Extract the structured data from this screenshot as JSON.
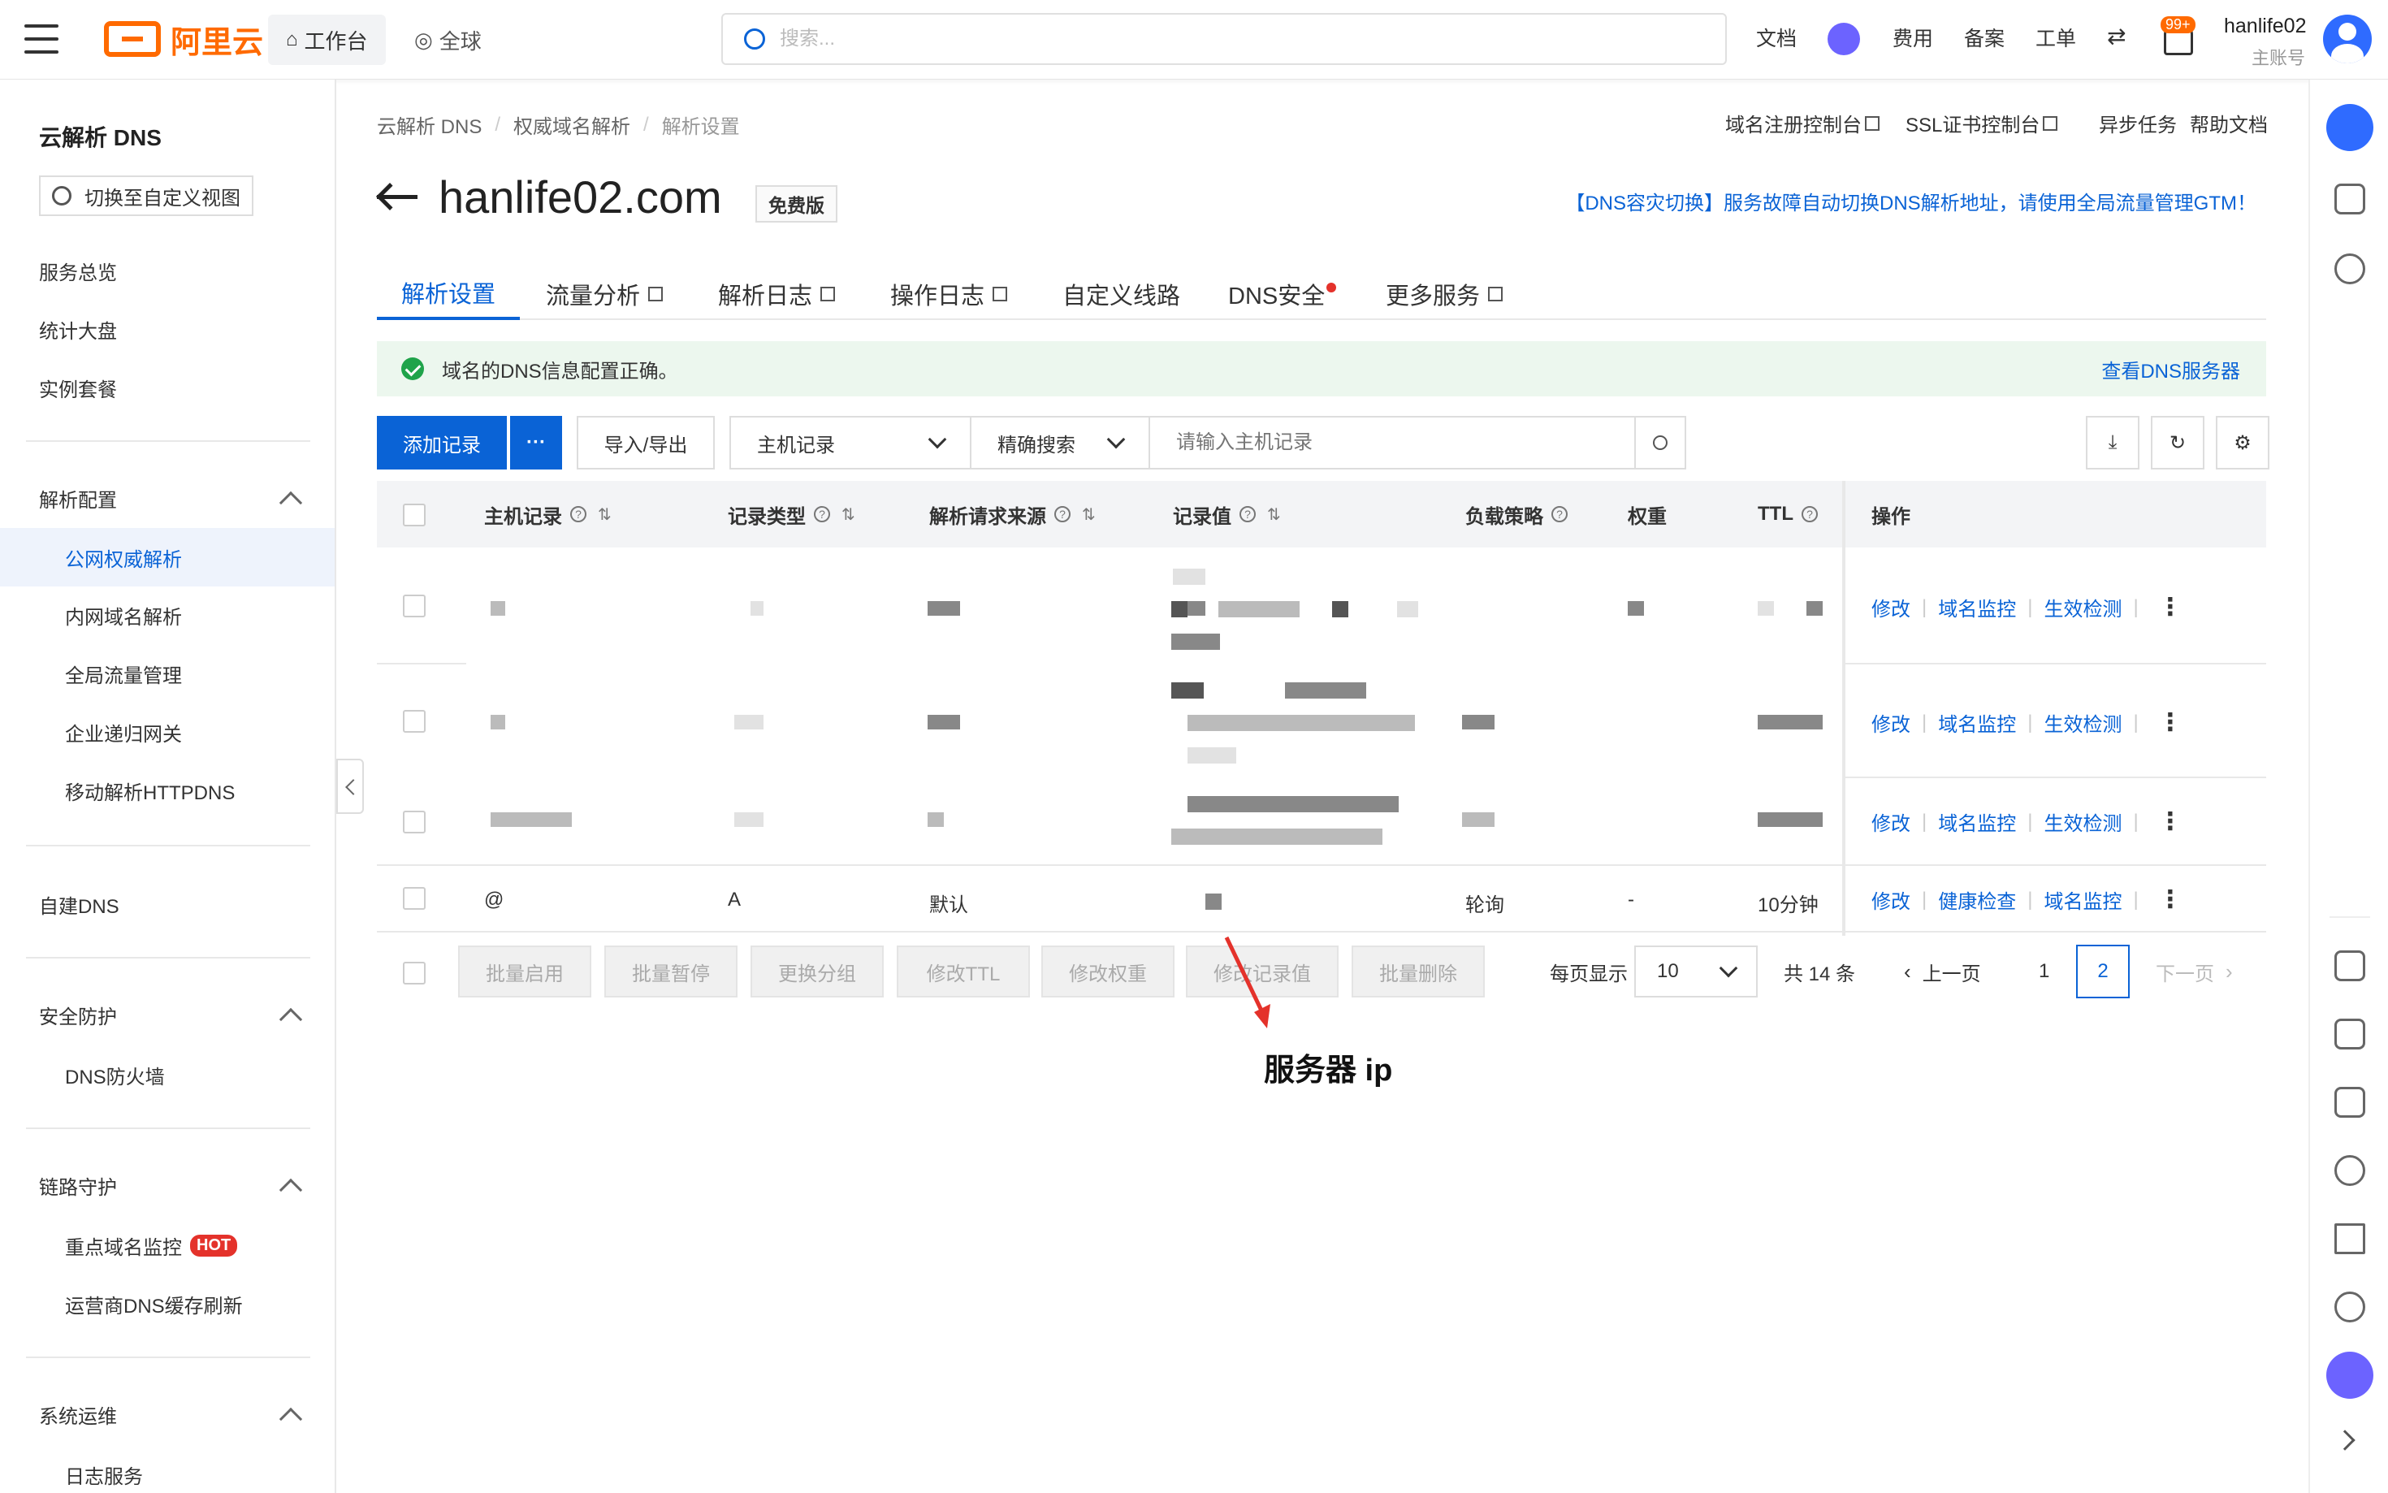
{
  "topbar": {
    "logo_text": "阿里云",
    "workbench": "工作台",
    "region": "全球",
    "search_placeholder": "搜索...",
    "nav": [
      "文档",
      "费用",
      "备案",
      "工单"
    ],
    "notification_badge": "99+",
    "username": "hanlife02",
    "account_type": "主账号"
  },
  "sidebar": {
    "title": "云解析 DNS",
    "custom_view": "切换至自定义视图",
    "top_items": [
      "服务总览",
      "统计大盘",
      "实例套餐"
    ],
    "group_resolve": "解析配置",
    "resolve_items": [
      "公网权威解析",
      "内网域名解析",
      "全局流量管理",
      "企业递归网关",
      "移动解析HTTPDNS"
    ],
    "self_dns": "自建DNS",
    "group_security": "安全防护",
    "security_items": [
      "DNS防火墙"
    ],
    "group_link": "链路守护",
    "link_items": [
      "重点域名监控",
      "运营商DNS缓存刷新"
    ],
    "hot_label": "HOT",
    "group_ops": "系统运维",
    "ops_items": [
      "日志服务"
    ]
  },
  "breadcrumb": [
    "云解析 DNS",
    "权威域名解析",
    "解析设置"
  ],
  "toplinks": [
    "域名注册控制台",
    "SSL证书控制台",
    "异步任务",
    "帮助文档"
  ],
  "page": {
    "domain": "hanlife02.com",
    "edition": "免费版",
    "banner": "【DNS容灾切换】服务故障自动切换DNS解析地址，请使用全局流量管理GTM！"
  },
  "tabs": [
    "解析设置",
    "流量分析",
    "解析日志",
    "操作日志",
    "自定义线路",
    "DNS安全",
    "更多服务"
  ],
  "status": {
    "message": "域名的DNS信息配置正确。",
    "link": "查看DNS服务器"
  },
  "toolbar": {
    "add": "添加记录",
    "more": "···",
    "import_export": "导入/导出",
    "field_select": "主机记录",
    "match_select": "精确搜索",
    "search_placeholder": "请输入主机记录"
  },
  "table": {
    "headers": [
      "主机记录",
      "记录类型",
      "解析请求来源",
      "记录值",
      "负载策略",
      "权重",
      "TTL",
      "操作"
    ],
    "ops_labels": {
      "edit": "修改",
      "monitor": "域名监控",
      "check": "生效检测",
      "health": "健康检查"
    },
    "last_row": {
      "host": "@",
      "type": "A",
      "source": "默认",
      "policy": "轮询",
      "weight": "-",
      "ttl": "10分钟"
    }
  },
  "bottom": {
    "batch": [
      "批量启用",
      "批量暂停",
      "更换分组",
      "修改TTL",
      "修改权重",
      "修改记录值",
      "批量删除"
    ],
    "per_page_label": "每页显示",
    "per_page": "10",
    "total": "共 14 条",
    "prev": "上一页",
    "pages": [
      "1",
      "2"
    ],
    "next": "下一页"
  },
  "annotation": "服务器 ip",
  "colors": {
    "accent": "#0a63d6",
    "brand": "#ff6a00",
    "success": "#1fa34a",
    "alert": "#e4322b"
  }
}
